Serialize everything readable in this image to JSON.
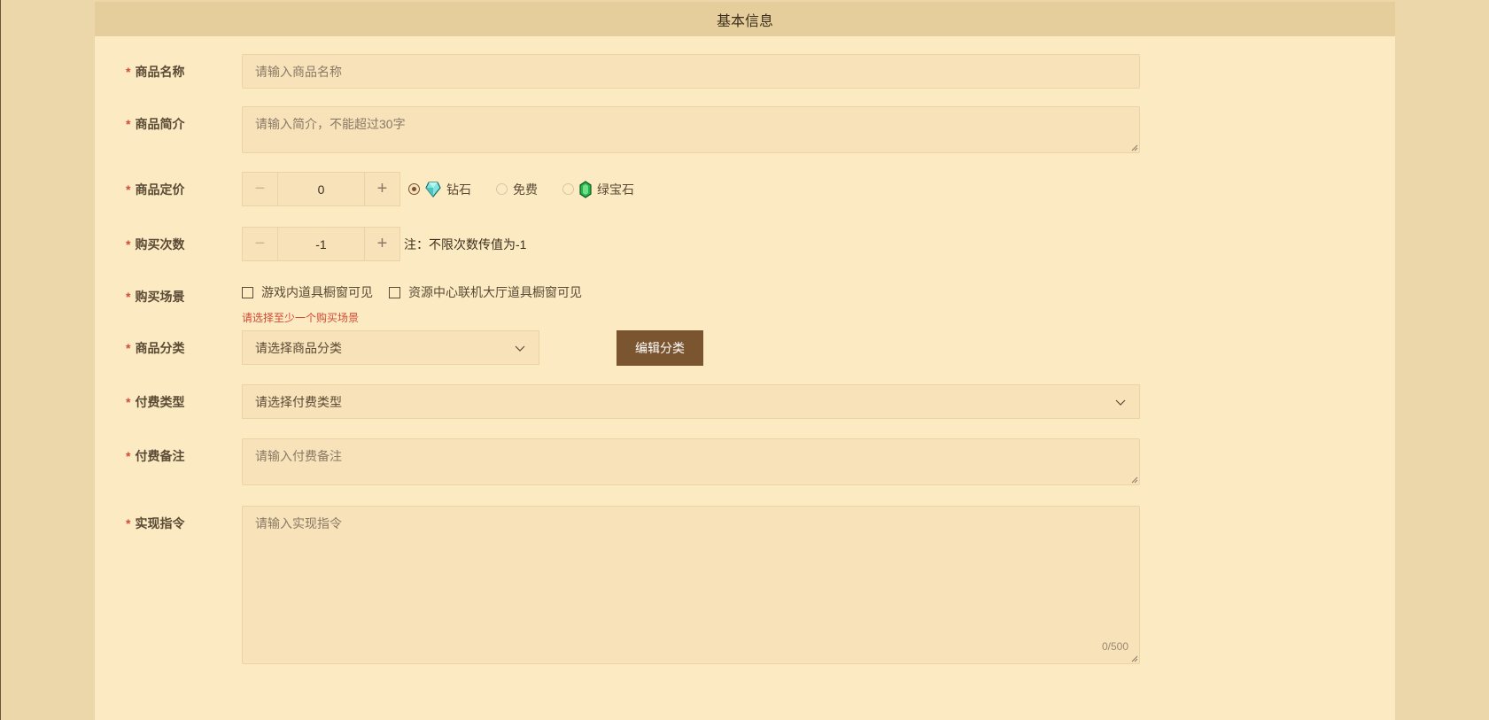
{
  "header": {
    "title": "基本信息"
  },
  "required_mark": "*",
  "fields": {
    "name": {
      "label": "商品名称",
      "placeholder": "请输入商品名称"
    },
    "intro": {
      "label": "商品简介",
      "placeholder": "请输入简介，不能超过30字"
    },
    "price": {
      "label": "商品定价",
      "value": "0",
      "minus": "−",
      "plus": "+",
      "options": [
        {
          "label": "钻石",
          "checked": true,
          "icon": "diamond-icon"
        },
        {
          "label": "免费",
          "checked": false,
          "icon": ""
        },
        {
          "label": "绿宝石",
          "checked": false,
          "icon": "emerald-icon"
        }
      ]
    },
    "purchase_count": {
      "label": "购买次数",
      "value": "-1",
      "minus": "−",
      "plus": "+",
      "note": "注：不限次数传值为-1"
    },
    "scene": {
      "label": "购买场景",
      "options": [
        "游戏内道具橱窗可见",
        "资源中心联机大厅道具橱窗可见"
      ],
      "error": "请选择至少一个购买场景"
    },
    "category": {
      "label": "商品分类",
      "placeholder": "请选择商品分类",
      "edit_button": "编辑分类"
    },
    "pay_type": {
      "label": "付费类型",
      "placeholder": "请选择付费类型"
    },
    "pay_note": {
      "label": "付费备注",
      "placeholder": "请输入付费备注"
    },
    "command": {
      "label": "实现指令",
      "placeholder": "请输入实现指令",
      "counter": "0/500"
    }
  },
  "colors": {
    "accent": "#7b5430",
    "required": "#d04a36",
    "panel_bg": "#fcebc2",
    "header_bg": "#e6cd9c"
  }
}
